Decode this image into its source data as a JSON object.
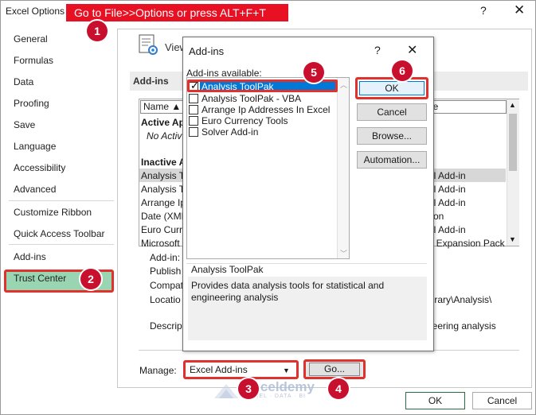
{
  "window": {
    "title": "Excel Options",
    "help": "?",
    "close": "✕"
  },
  "banner": "Go to File>>Options or press ALT+F+T",
  "badges": [
    "1",
    "2",
    "3",
    "4",
    "5",
    "6"
  ],
  "sidebar": {
    "items": [
      {
        "label": "General"
      },
      {
        "label": "Formulas"
      },
      {
        "label": "Data"
      },
      {
        "label": "Proofing"
      },
      {
        "label": "Save"
      },
      {
        "label": "Language"
      },
      {
        "label": "Accessibility"
      },
      {
        "label": "Advanced"
      },
      {
        "label": "Customize Ribbon"
      },
      {
        "label": "Quick Access Toolbar"
      },
      {
        "label": "Add-ins"
      },
      {
        "label": "Trust Center"
      }
    ],
    "active": "Add-ins"
  },
  "main": {
    "view_text": "View",
    "section_heading": "Add-ins",
    "columns": {
      "name": "Name ▲",
      "type": "pe"
    },
    "rows_left": [
      "Active Ap",
      "No Activ",
      "Inactive A",
      "Analysis T",
      "Analysis T",
      "Arrange Ip",
      "Date (XML",
      "Euro Curr",
      "Microsoft"
    ],
    "rows_right": [
      "el Add-in",
      "el Add-in",
      "el Add-in",
      "tion",
      "el Add-in",
      "L Expansion Pack"
    ],
    "details_left": [
      "Add-in:",
      "Publish",
      "Compat",
      "Locatio",
      "Descript"
    ],
    "details_right": [
      "ibrary\\Analysis\\",
      "neering analysis"
    ],
    "manage_label": "Manage:",
    "manage_value": "Excel Add-ins",
    "go_label": "Go...",
    "ok_label": "OK",
    "cancel_label": "Cancel"
  },
  "watermark": {
    "name": "exceldemy",
    "tagline": "EXCEL · DATA · BI"
  },
  "dialog": {
    "title": "Add-ins",
    "help": "?",
    "close": "✕",
    "available_label": "Add-ins available:",
    "items": [
      {
        "label": "Analysis ToolPak",
        "checked": true
      },
      {
        "label": "Analysis ToolPak - VBA",
        "checked": false
      },
      {
        "label": "Arrange Ip Addresses In Excel",
        "checked": false
      },
      {
        "label": "Euro Currency Tools",
        "checked": false
      },
      {
        "label": "Solver Add-in",
        "checked": false
      }
    ],
    "buttons": {
      "ok": "OK",
      "cancel": "Cancel",
      "browse": "Browse...",
      "automation": "Automation..."
    },
    "description_title": "Analysis ToolPak",
    "description": "Provides data analysis tools for statistical and engineering analysis"
  },
  "colors": {
    "accent": "#e0312c",
    "badge": "#c8102e",
    "active_bg": "#9ad5b2",
    "selection": "#0078d7"
  }
}
